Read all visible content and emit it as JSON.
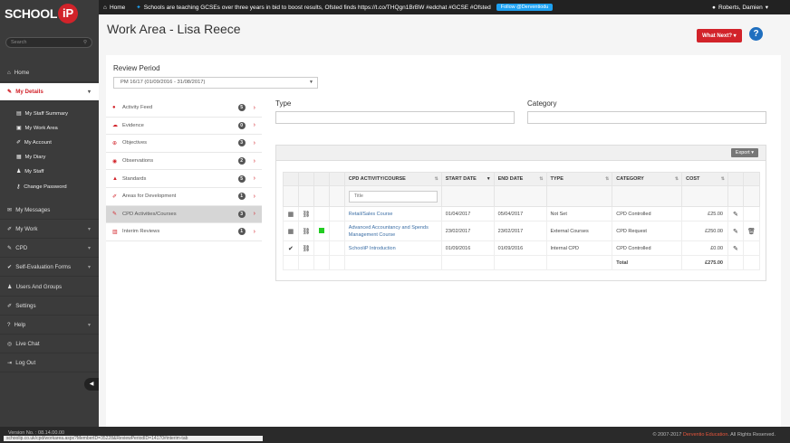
{
  "topbar": {
    "home_label": "Home",
    "tweet_text": "Schools are teaching GCSEs over three years in bid to boost results, Ofsted finds https://t.co/THQgn1BrBW #edchat #GCSE #Ofsted",
    "follow_label": "Follow @Derventiodu",
    "user_name": "Roberts, Damien"
  },
  "logo": {
    "text": "SCHOOL",
    "ip": "iP"
  },
  "search": {
    "placeholder": "Search"
  },
  "sidebar": {
    "items": [
      {
        "label": "Home"
      },
      {
        "label": "My Details"
      },
      {
        "label": "My Messages"
      },
      {
        "label": "My Work"
      },
      {
        "label": "CPD"
      },
      {
        "label": "Self-Evaluation Forms"
      },
      {
        "label": "Users And Groups"
      },
      {
        "label": "Settings"
      },
      {
        "label": "Help"
      },
      {
        "label": "Live Chat"
      },
      {
        "label": "Log Out"
      }
    ],
    "subitems": [
      {
        "label": "My Staff Summary"
      },
      {
        "label": "My Work Area"
      },
      {
        "label": "My Account"
      },
      {
        "label": "My Diary"
      },
      {
        "label": "My Staff"
      },
      {
        "label": "Change Password"
      }
    ]
  },
  "page": {
    "title": "Work Area - Lisa Reece",
    "what_next": "What Next?",
    "help": "?"
  },
  "review_period": {
    "label": "Review Period",
    "selected": "PM 16/17 (01/09/2016 - 31/08/2017)"
  },
  "menu": [
    {
      "label": "Activity Feed",
      "count": "5"
    },
    {
      "label": "Evidence",
      "count": "0"
    },
    {
      "label": "Objectives",
      "count": "3"
    },
    {
      "label": "Observations",
      "count": "2"
    },
    {
      "label": "Standards",
      "count": "5"
    },
    {
      "label": "Areas for Development",
      "count": "1"
    },
    {
      "label": "CPD Activities/Courses",
      "count": "3"
    },
    {
      "label": "Interim Reviews",
      "count": "1"
    }
  ],
  "filters": {
    "type_label": "Type",
    "category_label": "Category"
  },
  "grid": {
    "export_label": "Export",
    "headers": [
      "CPD ACTIVITY/COURSE",
      "START DATE",
      "END DATE",
      "TYPE",
      "CATEGORY",
      "COST"
    ],
    "title_placeholder": "Title",
    "rows": [
      {
        "course": "Retail/Sales Course",
        "start": "01/04/2017",
        "end": "05/04/2017",
        "type": "Not Set",
        "category": "CPD Controlled",
        "cost": "£25.00"
      },
      {
        "course": "Advanced Accountancy and Spends Management Course",
        "start": "23/02/2017",
        "end": "23/02/2017",
        "type": "External Courses",
        "category": "CPD Request",
        "cost": "£250.00"
      },
      {
        "course": "SchooliP Introduction",
        "start": "01/09/2016",
        "end": "01/09/2016",
        "type": "Internal CPD",
        "category": "CPD Controlled",
        "cost": "£0.00"
      }
    ],
    "total_label": "Total",
    "total_value": "£275.00"
  },
  "footer": {
    "version": "Version No. : 08.14.00.00",
    "url": "schoolip.co.uk/cpd/workarea.aspx?MemberID=35228&ReviewPeriodID=14170#interim-tab",
    "copyright_prefix": "© 2007-2017",
    "brand": "Derventio Education",
    "rights": ". All Rights Reserved."
  },
  "colors": {
    "accent": "#d2232a",
    "sidebar": "#3b3b3b",
    "link": "#3b6ea5",
    "help": "#1f6fbf"
  }
}
